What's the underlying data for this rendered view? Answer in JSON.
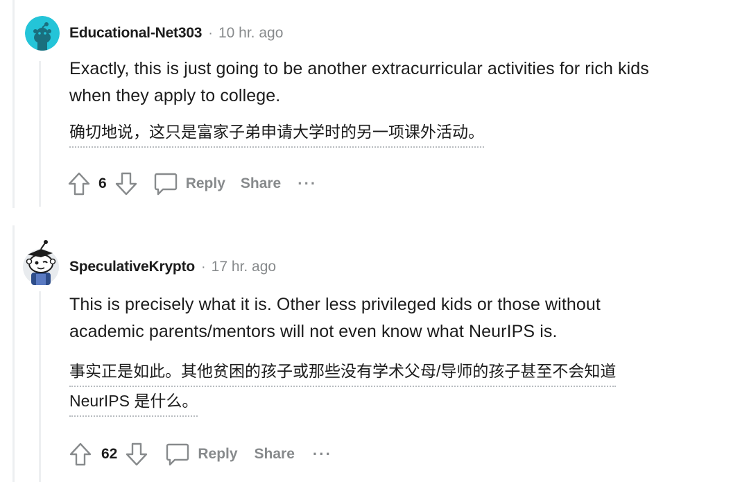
{
  "comments": [
    {
      "username": "Educational-Net303",
      "separator": "·",
      "timestamp": "10 hr. ago",
      "text_en": [
        "Exactly, this is just going to be another extracurricular activities for rich kids",
        "when they apply to college."
      ],
      "text_zh": [
        "确切地说，这只是富家子弟申请大学时的另一项课外活动。"
      ],
      "votes": "6",
      "reply_label": "Reply",
      "share_label": "Share",
      "more_label": "···",
      "avatar_color": "#24c4d8"
    },
    {
      "username": "SpeculativeKrypto",
      "separator": "·",
      "timestamp": "17 hr. ago",
      "text_en": [
        "This is precisely what it is. Other less privileged kids or those without",
        "academic parents/mentors will not even know what NeurIPS is."
      ],
      "text_zh": [
        "事实正是如此。其他贫困的孩子或那些没有学术父母/导师的孩子甚至不会知道",
        "NeurIPS 是什么。"
      ],
      "votes": "62",
      "reply_label": "Reply",
      "share_label": "Share",
      "more_label": "···",
      "avatar_color": "#e8ebee"
    }
  ],
  "colors": {
    "text_primary": "#1c1c1c",
    "text_muted": "#878a8c",
    "thread_line": "#edeff1",
    "dotted_underline": "#b8bcc0"
  },
  "icons": [
    "upvote-icon",
    "downvote-icon",
    "comment-bubble-icon",
    "snoo-avatar-icon",
    "more-options-icon"
  ]
}
